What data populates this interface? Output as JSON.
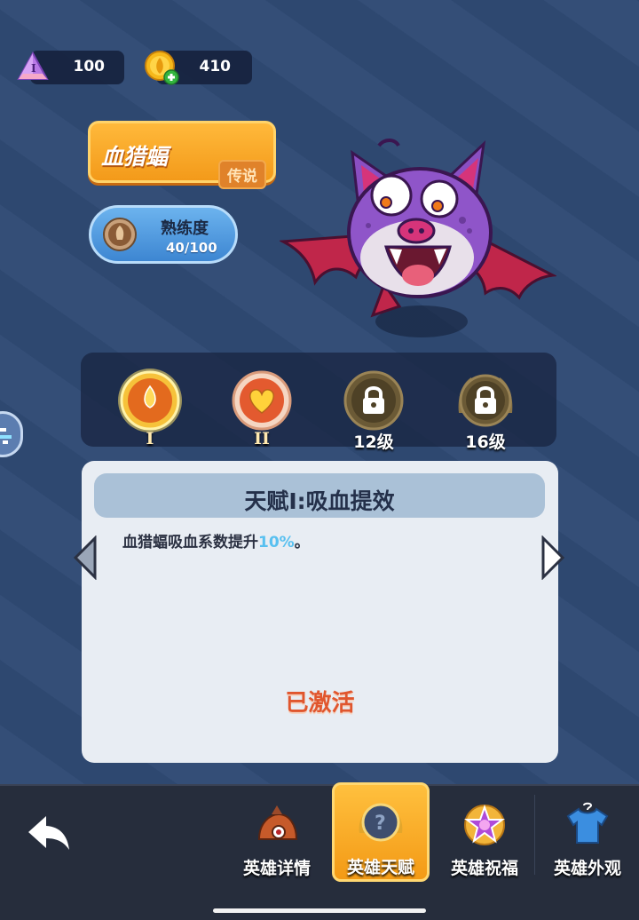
{
  "currency": {
    "gems": {
      "icon": "purple-gem-icon",
      "value": "100"
    },
    "coins": {
      "icon": "gold-coin-add-icon",
      "value": "410"
    }
  },
  "hero": {
    "name": "血猎蝠",
    "rarity": "传说",
    "proficiency_label": "熟练度",
    "proficiency_value": "40/100",
    "proficiency_progress": 0.4
  },
  "talents": [
    {
      "id": "I",
      "icon": "blood-drop-icon",
      "state": "selected",
      "numeral": "I"
    },
    {
      "id": "II",
      "icon": "heart-icon",
      "state": "unlocked",
      "numeral": "II"
    },
    {
      "id": "III",
      "icon": "lock-icon",
      "state": "locked",
      "level": "12级"
    },
    {
      "id": "IV",
      "icon": "lock-icon",
      "state": "locked",
      "level": "16级"
    }
  ],
  "detail": {
    "title": "天赋Ⅰ:吸血提效",
    "description_prefix": "血猎蝠吸血系数提升",
    "description_highlight": "10%",
    "description_suffix": "。",
    "status": "已激活"
  },
  "nav": {
    "back_icon": "back-arrow-icon",
    "tabs": [
      {
        "label": "英雄详情",
        "icon": "hero-details-icon",
        "active": false
      },
      {
        "label": "英雄天赋",
        "icon": "talent-question-icon",
        "active": true
      },
      {
        "label": "英雄祝福",
        "icon": "star-blessing-icon",
        "active": false
      },
      {
        "label": "英雄外观",
        "icon": "shirt-icon",
        "active": false,
        "badge": "2"
      }
    ]
  },
  "colors": {
    "background": "#2f4a74",
    "accent_orange": "#f5a623",
    "highlight_blue": "#58c0f0",
    "status_red": "#e0562e"
  }
}
